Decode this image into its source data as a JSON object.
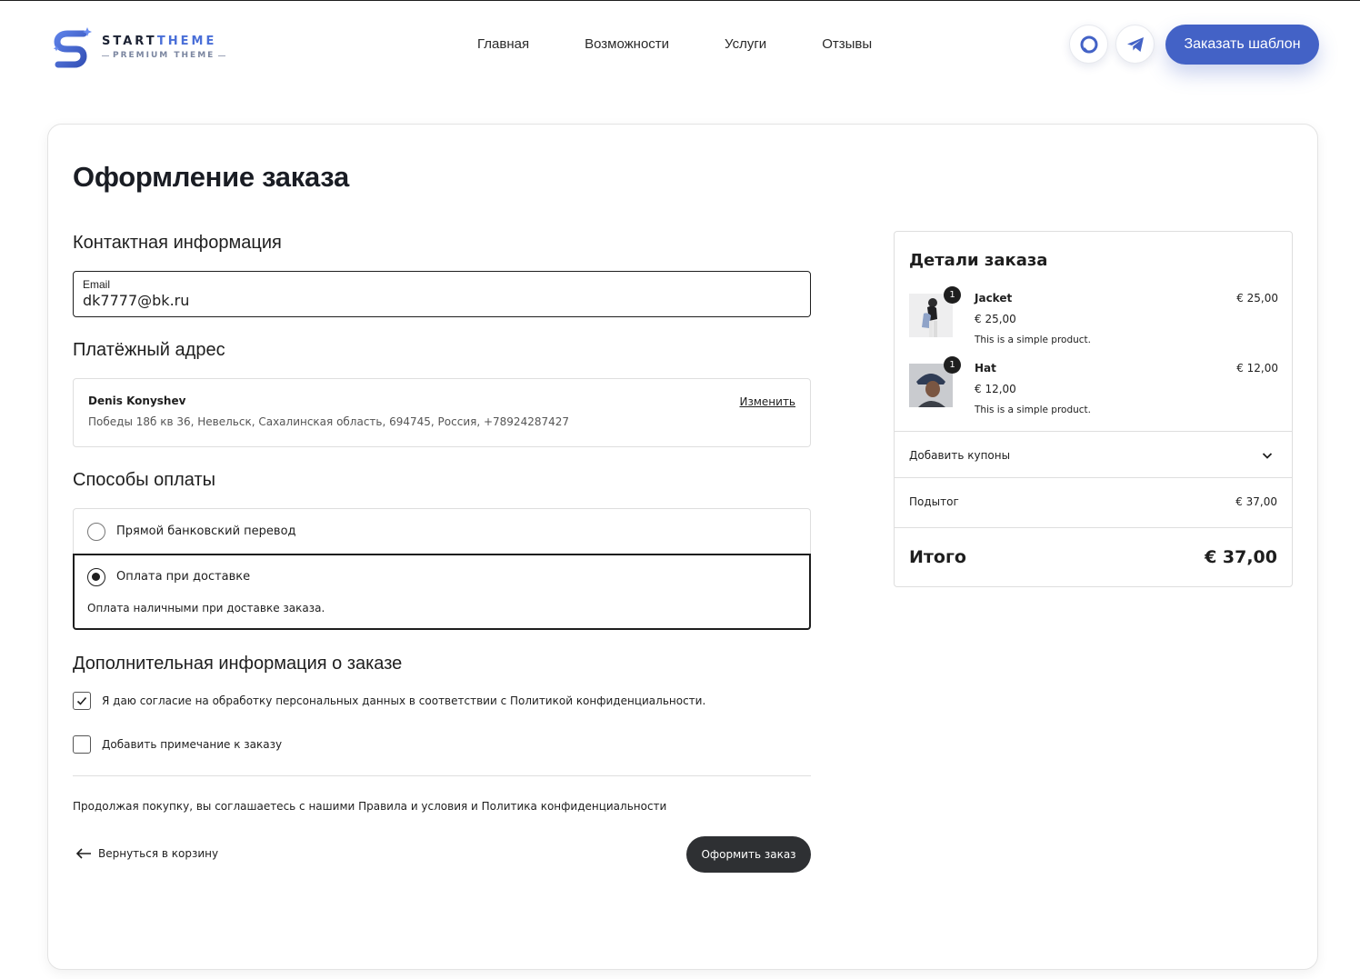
{
  "header": {
    "logo": {
      "name_main": "START",
      "name_accent": "THEME",
      "subtitle": "PREMIUM THEME"
    },
    "nav": [
      "Главная",
      "Возможности",
      "Услуги",
      "Отзывы"
    ],
    "cta_label": "Заказать шаблон",
    "icons": [
      "chat-icon",
      "telegram-icon"
    ],
    "accent_color": "#4362c6"
  },
  "checkout": {
    "title": "Оформление заказа",
    "contact": {
      "title": "Контактная информация",
      "email_label": "Email",
      "email_value": "dk7777@bk.ru"
    },
    "billing": {
      "title": "Платёжный адрес",
      "name": "Denis Konyshev",
      "address": "Победы 18б кв 36, Невельск, Сахалинская область, 694745, Россия, +78924287427",
      "edit_label": "Изменить"
    },
    "payment": {
      "title": "Способы оплаты",
      "options": [
        {
          "label": "Прямой банковский перевод",
          "selected": false
        },
        {
          "label": "Оплата при доставке",
          "selected": true,
          "description": "Оплата наличными при доставке заказа."
        }
      ]
    },
    "extra": {
      "title": "Дополнительная информация о заказе",
      "consent_label": "Я даю согласие на обработку персональных данных в соответствии с Политикой конфиденциальности.",
      "consent_checked": true,
      "note_label": "Добавить примечание к заказу",
      "note_checked": false
    },
    "terms": "Продолжая покупку, вы соглашаетесь с нашими Правила и условия и Политика конфиденциальности",
    "back_label": "Вернуться в корзину",
    "submit_label": "Оформить заказ"
  },
  "summary": {
    "title": "Детали заказа",
    "items": [
      {
        "name": "Jacket",
        "qty": "1",
        "unit_price": "€ 25,00",
        "description": "This is a simple product.",
        "total": "€ 25,00"
      },
      {
        "name": "Hat",
        "qty": "1",
        "unit_price": "€ 12,00",
        "description": "This is a simple product.",
        "total": "€ 12,00"
      }
    ],
    "coupon_label": "Добавить купоны",
    "subtotal_label": "Подытог",
    "subtotal_value": "€ 37,00",
    "total_label": "Итого",
    "total_value": "€ 37,00"
  }
}
